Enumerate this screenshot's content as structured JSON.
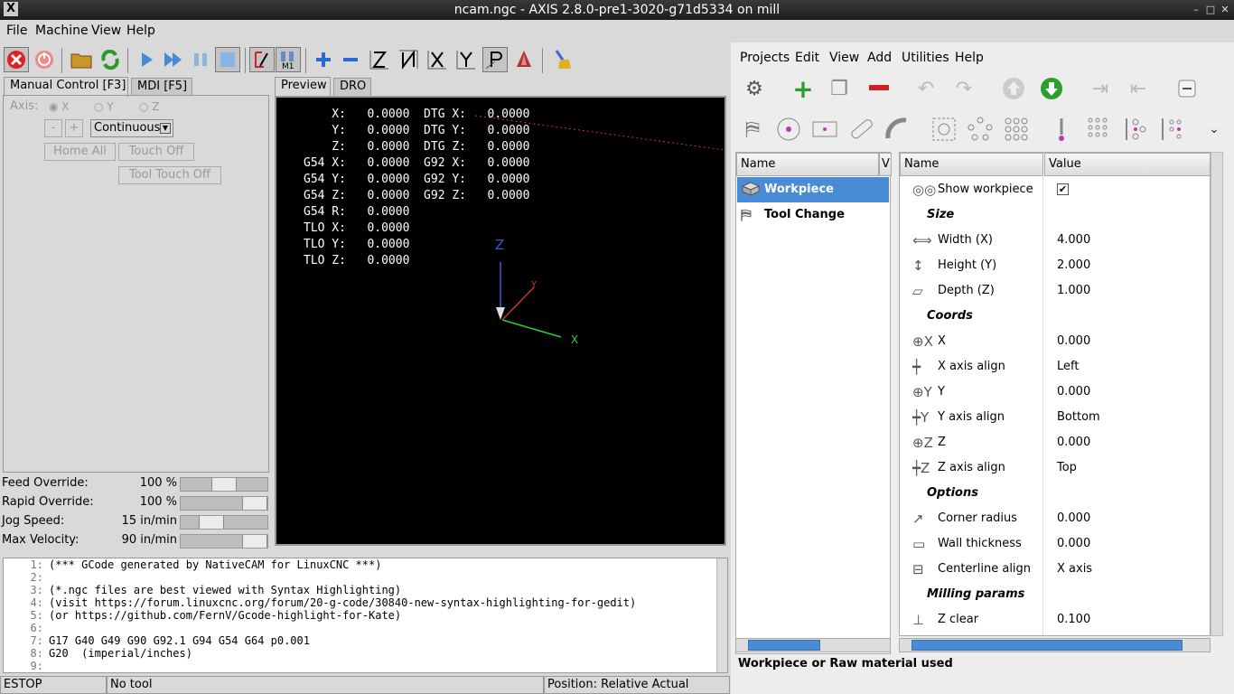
{
  "window": {
    "title": "ncam.ngc - AXIS 2.8.0-pre1-3020-g71d5334 on mill",
    "controls": [
      "–",
      "□",
      "✕"
    ]
  },
  "menu": [
    "File",
    "Machine",
    "View",
    "Help"
  ],
  "toolbar": {
    "icons": [
      "estop-icon",
      "power-icon",
      "open-file-icon",
      "reload-icon",
      "run-icon",
      "step-icon",
      "pause-icon",
      "stop-icon",
      "block-delete-icon",
      "optional-stop-icon",
      "zoom-in-icon",
      "zoom-out-icon",
      "view-z-icon",
      "view-z2-icon",
      "view-x-icon",
      "view-y-icon",
      "view-p-icon",
      "rotate-icon",
      "clear-plot-icon"
    ],
    "m1_label": "M1"
  },
  "left_tabs": {
    "manual": "Manual Control [F3]",
    "mdi": "MDI [F5]"
  },
  "manual": {
    "axis_label": "Axis:",
    "axes": [
      "X",
      "Y",
      "Z"
    ],
    "minus": "-",
    "plus": "+",
    "jog_mode": "Continuous",
    "home_all": "Home All",
    "touch_off": "Touch Off",
    "tool_touch_off": "Tool Touch Off"
  },
  "overrides": [
    {
      "label": "Feed Override:",
      "value": "100 %",
      "level": 0.5
    },
    {
      "label": "Rapid Override:",
      "value": "100 %",
      "level": 1.0
    },
    {
      "label": "Jog Speed:",
      "value": "15 in/min",
      "level": 0.3
    },
    {
      "label": "Max Velocity:",
      "value": "90 in/min",
      "level": 1.0
    }
  ],
  "preview_tabs": {
    "preview": "Preview",
    "dro": "DRO"
  },
  "dro_lines": [
    "    X:   0.0000  DTG X:   0.0000",
    "    Y:   0.0000  DTG Y:   0.0000",
    "    Z:   0.0000  DTG Z:   0.0000",
    "G54 X:   0.0000  G92 X:   0.0000",
    "G54 Y:   0.0000  G92 Y:   0.0000",
    "G54 Z:   0.0000  G92 Z:   0.0000",
    "G54 R:   0.0000",
    "TLO X:   0.0000",
    "TLO Y:   0.0000",
    "TLO Z:   0.0000"
  ],
  "axis_labels": {
    "z": "Z",
    "x": "X",
    "y": "Y"
  },
  "gcode": [
    {
      "n": "1:",
      "t": "(*** GCode generated by NativeCAM for LinuxCNC ***)"
    },
    {
      "n": "2:",
      "t": ""
    },
    {
      "n": "3:",
      "t": "(*.ngc files are best viewed with Syntax Highlighting)"
    },
    {
      "n": "4:",
      "t": "(visit https://forum.linuxcnc.org/forum/20-g-code/30840-new-syntax-highlighting-for-gedit)"
    },
    {
      "n": "5:",
      "t": "(or https://github.com/FernV/Gcode-highlight-for-Kate)"
    },
    {
      "n": "6:",
      "t": ""
    },
    {
      "n": "7:",
      "t": "G17 G40 G49 G90 G92.1 G94 G54 G64 p0.001"
    },
    {
      "n": "8:",
      "t": "G20  (imperial/inches)"
    },
    {
      "n": "9:",
      "t": ""
    }
  ],
  "status": {
    "estop": "ESTOP",
    "tool": "No tool",
    "position": "Position: Relative Actual"
  },
  "ncam": {
    "menu": [
      "Projects",
      "Edit",
      "View",
      "Add",
      "Utilities",
      "Help"
    ],
    "tree_header": {
      "name": "Name",
      "v": "V"
    },
    "tree": [
      {
        "label": "Workpiece",
        "selected": true,
        "icon": "workpiece-icon"
      },
      {
        "label": "Tool Change",
        "selected": false,
        "icon": "tool-change-icon"
      }
    ],
    "prop_header": {
      "name": "Name",
      "value": "Value"
    },
    "props": [
      {
        "name": "Show workpiece",
        "check": "✔",
        "icon": "glasses-icon",
        "type": "check"
      },
      {
        "name": "Size",
        "type": "sec"
      },
      {
        "name": "Width (X)",
        "value": "4.000",
        "icon": "width-icon"
      },
      {
        "name": "Height (Y)",
        "value": "2.000",
        "icon": "height-icon"
      },
      {
        "name": "Depth (Z)",
        "value": "1.000",
        "icon": "depth-icon"
      },
      {
        "name": "Coords",
        "type": "sec"
      },
      {
        "name": "X",
        "value": "0.000",
        "icon": "x-coord-icon"
      },
      {
        "name": "X axis align",
        "value": "Left",
        "icon": "x-align-icon"
      },
      {
        "name": "Y",
        "value": "0.000",
        "icon": "y-coord-icon"
      },
      {
        "name": "Y axis align",
        "value": "Bottom",
        "icon": "y-align-icon"
      },
      {
        "name": "Z",
        "value": "0.000",
        "icon": "z-coord-icon"
      },
      {
        "name": "Z axis align",
        "value": "Top",
        "icon": "z-align-icon"
      },
      {
        "name": "Options",
        "type": "sec"
      },
      {
        "name": "Corner radius",
        "value": "0.000",
        "icon": "corner-radius-icon"
      },
      {
        "name": "Wall thickness",
        "value": "0.000",
        "icon": "wall-thickness-icon"
      },
      {
        "name": "Centerline align",
        "value": "X axis",
        "icon": "centerline-icon"
      },
      {
        "name": "Milling params",
        "type": "sec"
      },
      {
        "name": "Z clear",
        "value": "0.100",
        "icon": "z-clear-icon"
      }
    ],
    "status_text": "Workpiece or Raw material used"
  }
}
